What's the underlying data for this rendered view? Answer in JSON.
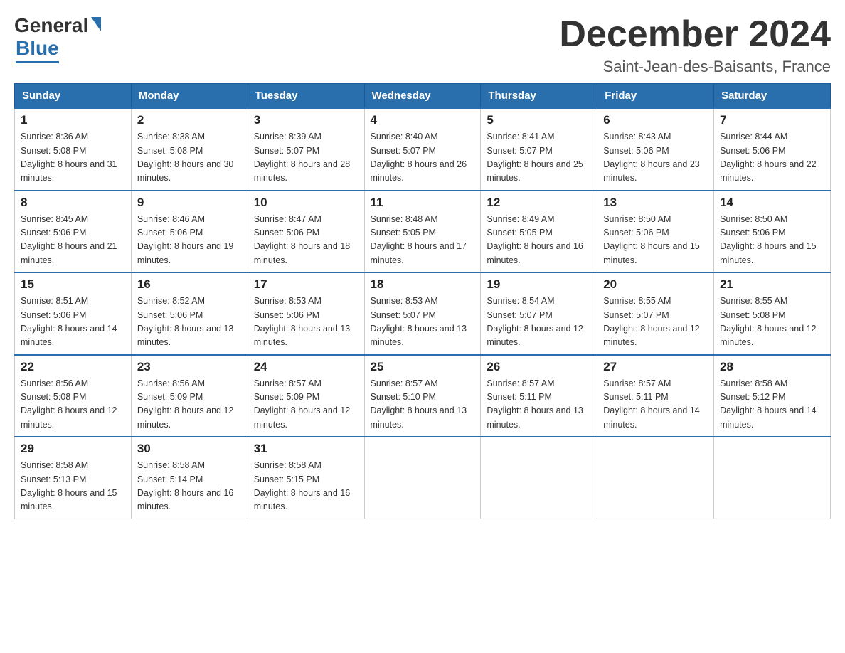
{
  "logo": {
    "general": "General",
    "blue": "Blue"
  },
  "title": "December 2024",
  "location": "Saint-Jean-des-Baisants, France",
  "days_of_week": [
    "Sunday",
    "Monday",
    "Tuesday",
    "Wednesday",
    "Thursday",
    "Friday",
    "Saturday"
  ],
  "weeks": [
    [
      {
        "day": "1",
        "sunrise": "8:36 AM",
        "sunset": "5:08 PM",
        "daylight": "8 hours and 31 minutes."
      },
      {
        "day": "2",
        "sunrise": "8:38 AM",
        "sunset": "5:08 PM",
        "daylight": "8 hours and 30 minutes."
      },
      {
        "day": "3",
        "sunrise": "8:39 AM",
        "sunset": "5:07 PM",
        "daylight": "8 hours and 28 minutes."
      },
      {
        "day": "4",
        "sunrise": "8:40 AM",
        "sunset": "5:07 PM",
        "daylight": "8 hours and 26 minutes."
      },
      {
        "day": "5",
        "sunrise": "8:41 AM",
        "sunset": "5:07 PM",
        "daylight": "8 hours and 25 minutes."
      },
      {
        "day": "6",
        "sunrise": "8:43 AM",
        "sunset": "5:06 PM",
        "daylight": "8 hours and 23 minutes."
      },
      {
        "day": "7",
        "sunrise": "8:44 AM",
        "sunset": "5:06 PM",
        "daylight": "8 hours and 22 minutes."
      }
    ],
    [
      {
        "day": "8",
        "sunrise": "8:45 AM",
        "sunset": "5:06 PM",
        "daylight": "8 hours and 21 minutes."
      },
      {
        "day": "9",
        "sunrise": "8:46 AM",
        "sunset": "5:06 PM",
        "daylight": "8 hours and 19 minutes."
      },
      {
        "day": "10",
        "sunrise": "8:47 AM",
        "sunset": "5:06 PM",
        "daylight": "8 hours and 18 minutes."
      },
      {
        "day": "11",
        "sunrise": "8:48 AM",
        "sunset": "5:05 PM",
        "daylight": "8 hours and 17 minutes."
      },
      {
        "day": "12",
        "sunrise": "8:49 AM",
        "sunset": "5:05 PM",
        "daylight": "8 hours and 16 minutes."
      },
      {
        "day": "13",
        "sunrise": "8:50 AM",
        "sunset": "5:06 PM",
        "daylight": "8 hours and 15 minutes."
      },
      {
        "day": "14",
        "sunrise": "8:50 AM",
        "sunset": "5:06 PM",
        "daylight": "8 hours and 15 minutes."
      }
    ],
    [
      {
        "day": "15",
        "sunrise": "8:51 AM",
        "sunset": "5:06 PM",
        "daylight": "8 hours and 14 minutes."
      },
      {
        "day": "16",
        "sunrise": "8:52 AM",
        "sunset": "5:06 PM",
        "daylight": "8 hours and 13 minutes."
      },
      {
        "day": "17",
        "sunrise": "8:53 AM",
        "sunset": "5:06 PM",
        "daylight": "8 hours and 13 minutes."
      },
      {
        "day": "18",
        "sunrise": "8:53 AM",
        "sunset": "5:07 PM",
        "daylight": "8 hours and 13 minutes."
      },
      {
        "day": "19",
        "sunrise": "8:54 AM",
        "sunset": "5:07 PM",
        "daylight": "8 hours and 12 minutes."
      },
      {
        "day": "20",
        "sunrise": "8:55 AM",
        "sunset": "5:07 PM",
        "daylight": "8 hours and 12 minutes."
      },
      {
        "day": "21",
        "sunrise": "8:55 AM",
        "sunset": "5:08 PM",
        "daylight": "8 hours and 12 minutes."
      }
    ],
    [
      {
        "day": "22",
        "sunrise": "8:56 AM",
        "sunset": "5:08 PM",
        "daylight": "8 hours and 12 minutes."
      },
      {
        "day": "23",
        "sunrise": "8:56 AM",
        "sunset": "5:09 PM",
        "daylight": "8 hours and 12 minutes."
      },
      {
        "day": "24",
        "sunrise": "8:57 AM",
        "sunset": "5:09 PM",
        "daylight": "8 hours and 12 minutes."
      },
      {
        "day": "25",
        "sunrise": "8:57 AM",
        "sunset": "5:10 PM",
        "daylight": "8 hours and 13 minutes."
      },
      {
        "day": "26",
        "sunrise": "8:57 AM",
        "sunset": "5:11 PM",
        "daylight": "8 hours and 13 minutes."
      },
      {
        "day": "27",
        "sunrise": "8:57 AM",
        "sunset": "5:11 PM",
        "daylight": "8 hours and 14 minutes."
      },
      {
        "day": "28",
        "sunrise": "8:58 AM",
        "sunset": "5:12 PM",
        "daylight": "8 hours and 14 minutes."
      }
    ],
    [
      {
        "day": "29",
        "sunrise": "8:58 AM",
        "sunset": "5:13 PM",
        "daylight": "8 hours and 15 minutes."
      },
      {
        "day": "30",
        "sunrise": "8:58 AM",
        "sunset": "5:14 PM",
        "daylight": "8 hours and 16 minutes."
      },
      {
        "day": "31",
        "sunrise": "8:58 AM",
        "sunset": "5:15 PM",
        "daylight": "8 hours and 16 minutes."
      },
      null,
      null,
      null,
      null
    ]
  ]
}
